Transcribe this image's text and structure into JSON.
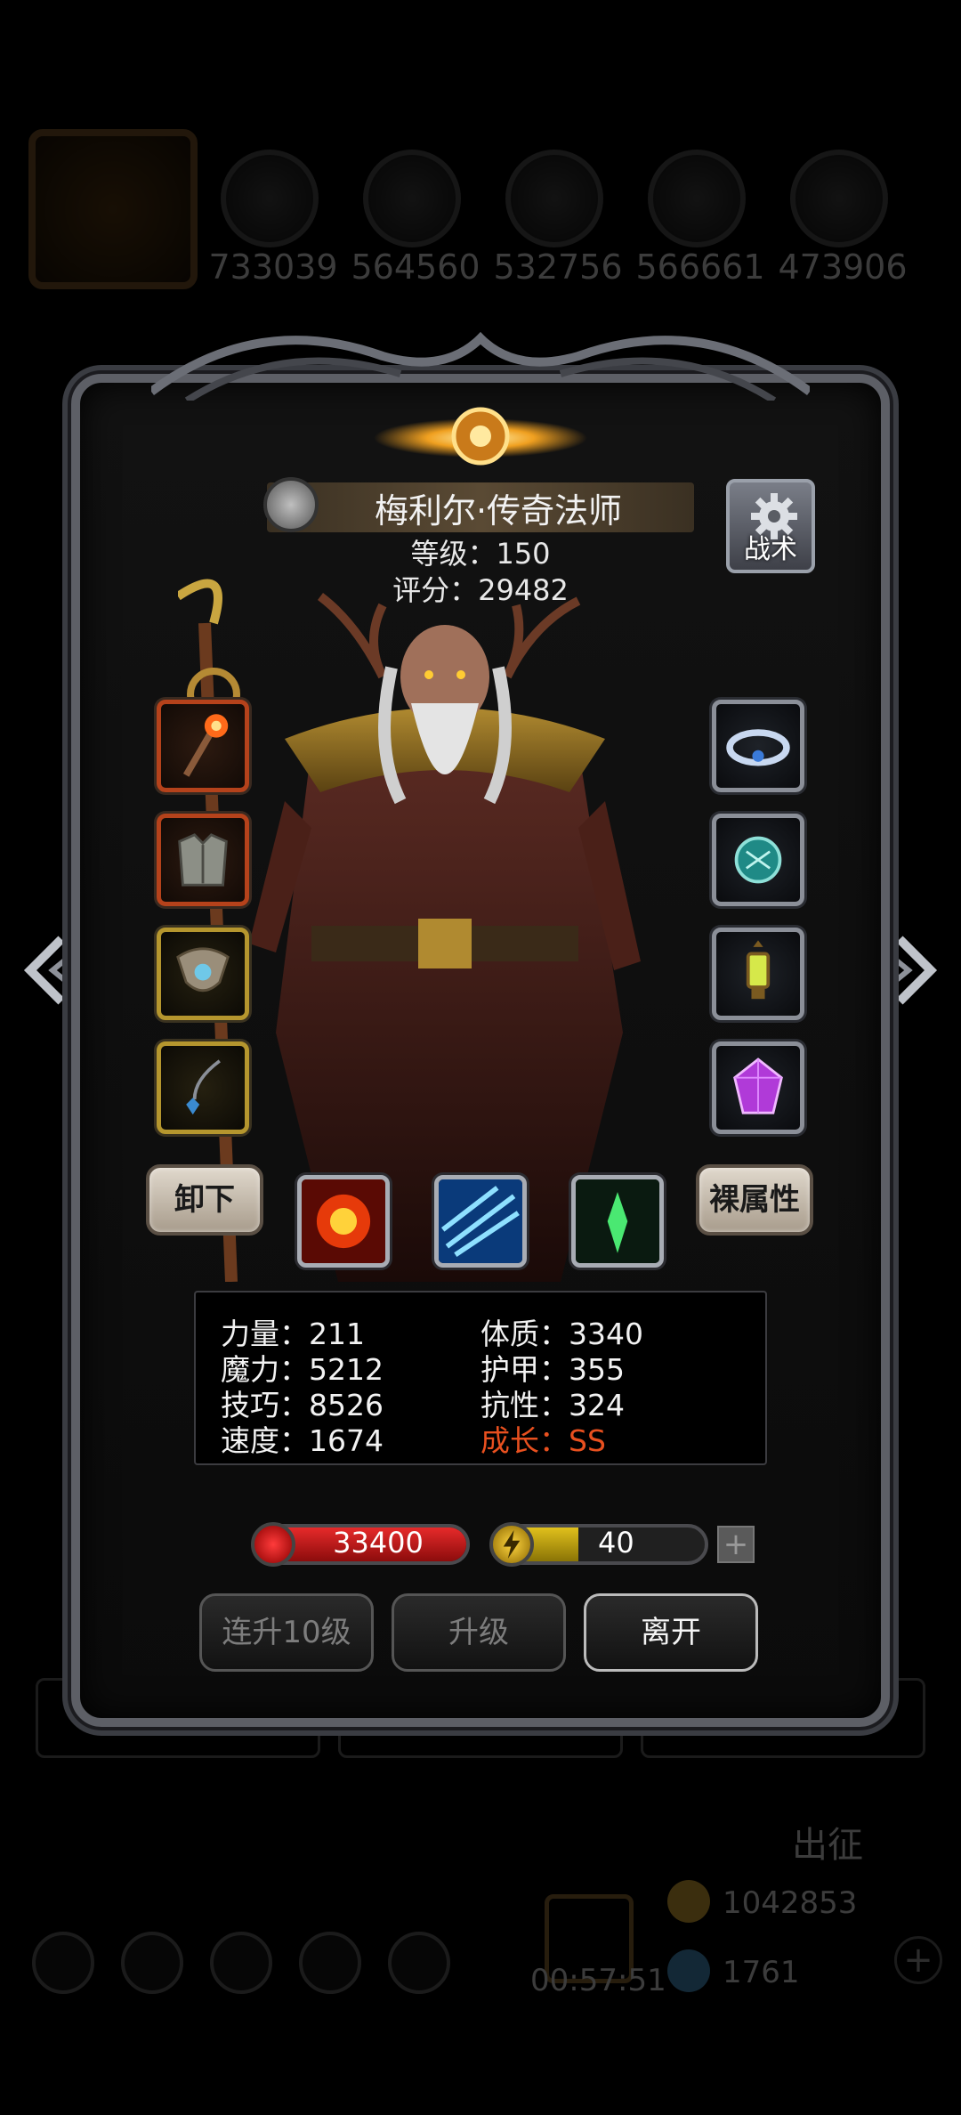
{
  "background": {
    "resources": [
      "733039",
      "564560",
      "532756",
      "566661",
      "473906"
    ],
    "expedition_label": "出征",
    "gold": "1042853",
    "gems": "1761",
    "timer": "00:57:51"
  },
  "hero": {
    "name": "梅利尔·传奇法师",
    "level": "等级：150",
    "score": "评分：29482"
  },
  "tactics_label": "战术",
  "buttons": {
    "unequip": "卸下",
    "base_attr": "裸属性",
    "level_up_10": "连升10级",
    "level_up": "升级",
    "leave": "离开"
  },
  "stats": {
    "strength": "力量：211",
    "magic": "魔力：5212",
    "skill": "技巧：8526",
    "speed": "速度：1674",
    "constitution": "体质：3340",
    "armor": "护甲：355",
    "resistance": "抗性：324",
    "growth": "成长：SS"
  },
  "hp": {
    "value": "33400",
    "fill": 1.0
  },
  "energy": {
    "value": "40",
    "fill": 0.4
  },
  "colors": {
    "growth_highlight": "#e8501f",
    "hp_bar": "#e62a2a",
    "energy_bar": "#e0c01c"
  },
  "icons": {
    "left_equipment": [
      "staff-weapon-icon",
      "chest-armor-icon",
      "amulet-icon",
      "necklace-icon"
    ],
    "right_equipment": [
      "crown-icon",
      "orb-icon",
      "lantern-icon",
      "purple-gem-icon"
    ],
    "skills": [
      "fire-burst-icon",
      "ice-slash-icon",
      "green-crystal-icon"
    ]
  }
}
